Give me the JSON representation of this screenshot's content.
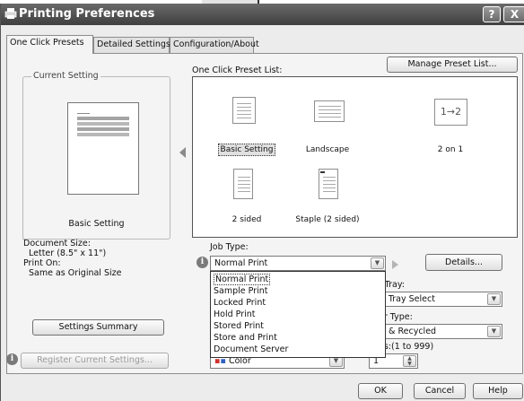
{
  "window": {
    "title": "Printing Preferences"
  },
  "titlebar": {
    "help_glyph": "?",
    "close_glyph": "X"
  },
  "tabs": [
    {
      "label": "One Click Presets"
    },
    {
      "label": "Detailed Settings"
    },
    {
      "label": "Configuration/About"
    }
  ],
  "current_setting": {
    "group_label": "Current Setting",
    "name": "Basic Setting",
    "document_size_label": "Document Size:",
    "document_size_value": "Letter (8.5\" x 11\")",
    "print_on_label": "Print On:",
    "print_on_value": "Same as Original Size",
    "summary_button": "Settings Summary",
    "register_button": "Register Current Settings..."
  },
  "presets": {
    "manage_button": "Manage Preset List...",
    "list_label": "One Click Preset List:",
    "items": [
      {
        "label": "Basic Setting",
        "icon": "document-portrait-icon"
      },
      {
        "label": "Landscape",
        "icon": "document-landscape-icon"
      },
      {
        "label": "2 on 1",
        "icon": "two-on-one-icon",
        "glyph": "1→2"
      },
      {
        "label": "2 sided",
        "icon": "two-sided-icon"
      },
      {
        "label": "Staple (2 sided)",
        "icon": "staple-icon"
      }
    ]
  },
  "job_type": {
    "label": "Job Type:",
    "value": "Normal Print",
    "details_button": "Details...",
    "options": [
      "Normal Print",
      "Sample Print",
      "Locked Print",
      "Hold Print",
      "Stored Print",
      "Store and Print",
      "Document Server"
    ]
  },
  "output_tray": {
    "label_fragment": "t Tray:",
    "value_fragment": "o Tray Select"
  },
  "paper_type": {
    "label_fragment": "er Type:",
    "value_fragment": "n & Recycled"
  },
  "color": {
    "value": "Color"
  },
  "copies": {
    "label_fragment": "es:(1 to 999)",
    "value": "1"
  },
  "dialog_buttons": {
    "ok": "OK",
    "cancel": "Cancel",
    "help": "Help"
  }
}
